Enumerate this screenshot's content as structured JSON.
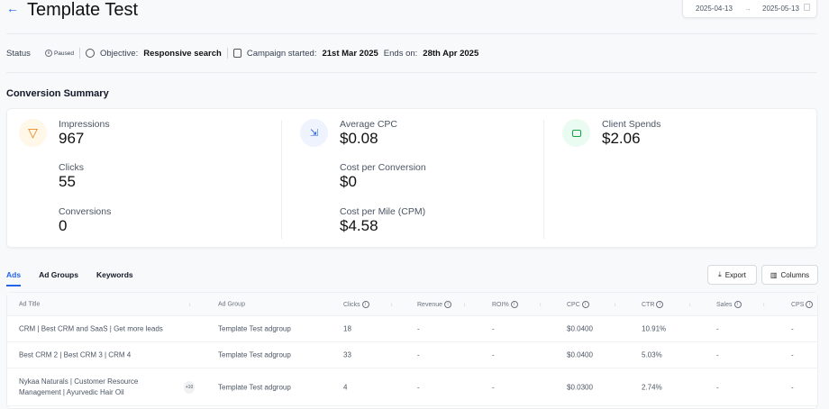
{
  "header": {
    "title": "Template Test",
    "date_start": "2025-04-13",
    "date_end": "2025-05-13"
  },
  "status": {
    "label": "Status",
    "badge": "Paused",
    "objective_label": "Objective:",
    "objective": "Responsive search",
    "started_label": "Campaign started:",
    "started": "21st Mar 2025",
    "ends_label": "Ends on:",
    "ends": "28th Apr 2025"
  },
  "summary": {
    "title": "Conversion Summary",
    "metrics": [
      {
        "label": "Impressions",
        "value": "967"
      },
      {
        "label": "Clicks",
        "value": "55"
      },
      {
        "label": "Conversions",
        "value": "0"
      },
      {
        "label": "Average CPC",
        "value": "$0.08"
      },
      {
        "label": "Cost per Conversion",
        "value": "$0"
      },
      {
        "label": "Cost per Mile (CPM)",
        "value": "$4.58"
      },
      {
        "label": "Client Spends",
        "value": "$2.06"
      }
    ]
  },
  "tabs": [
    "Ads",
    "Ad Groups",
    "Keywords"
  ],
  "toolbar": {
    "export": "Export",
    "columns": "Columns"
  },
  "table": {
    "columns": [
      "Ad Title",
      "Ad Group",
      "Clicks",
      "Revenue",
      "ROI%",
      "CPC",
      "CTR",
      "Sales",
      "CPS"
    ],
    "rows": [
      {
        "title": "CRM | Best CRM and SaaS | Get more leads",
        "group": "Template Test adgroup",
        "clicks": "18",
        "revenue": "-",
        "roi": "-",
        "cpc": "$0.0400",
        "ctr": "10.91%",
        "sales": "-",
        "cps": "-"
      },
      {
        "title": "Best CRM 2 | Best CRM 3 | CRM 4",
        "group": "Template Test adgroup",
        "clicks": "33",
        "revenue": "-",
        "roi": "-",
        "cpc": "$0.0400",
        "ctr": "5.03%",
        "sales": "-",
        "cps": "-"
      },
      {
        "title": "Nykaa Naturals | Customer Resource",
        "title2": "Management | Ayurvedic Hair Oil",
        "more": "+10",
        "group": "Template Test adgroup",
        "clicks": "4",
        "revenue": "-",
        "roi": "-",
        "cpc": "$0.0300",
        "ctr": "2.74%",
        "sales": "-",
        "cps": "-"
      }
    ]
  }
}
